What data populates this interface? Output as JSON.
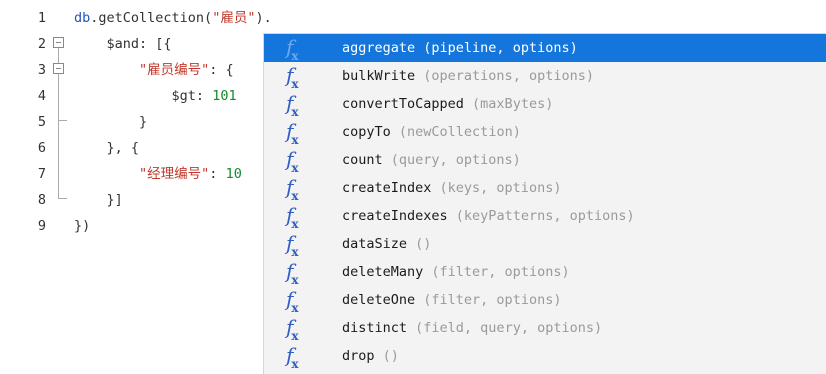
{
  "code_lines": [
    {
      "n": "1",
      "indent": "",
      "parts": [
        {
          "t": "db",
          "c": "kw"
        },
        {
          "t": ".getCollection(",
          "c": ""
        },
        {
          "t": "\"雇员\"",
          "c": "str"
        },
        {
          "t": ").",
          "c": ""
        }
      ]
    },
    {
      "n": "2",
      "indent": "    ",
      "parts": [
        {
          "t": "$and: [{",
          "c": ""
        }
      ]
    },
    {
      "n": "3",
      "indent": "        ",
      "parts": [
        {
          "t": "\"雇员编号\"",
          "c": "str"
        },
        {
          "t": ": {",
          "c": ""
        }
      ]
    },
    {
      "n": "4",
      "indent": "            ",
      "parts": [
        {
          "t": "$gt: ",
          "c": ""
        },
        {
          "t": "101",
          "c": "num"
        }
      ]
    },
    {
      "n": "5",
      "indent": "        ",
      "parts": [
        {
          "t": "}",
          "c": ""
        }
      ]
    },
    {
      "n": "6",
      "indent": "    ",
      "parts": [
        {
          "t": "}, {",
          "c": ""
        }
      ]
    },
    {
      "n": "7",
      "indent": "        ",
      "parts": [
        {
          "t": "\"经理编号\"",
          "c": "str"
        },
        {
          "t": ": ",
          "c": ""
        },
        {
          "t": "10",
          "c": "num"
        }
      ]
    },
    {
      "n": "8",
      "indent": "    ",
      "parts": [
        {
          "t": "}]",
          "c": ""
        }
      ]
    },
    {
      "n": "9",
      "indent": "",
      "parts": [
        {
          "t": "})",
          "c": ""
        }
      ]
    }
  ],
  "autocomplete": {
    "icon_glyph": "f",
    "icon_sub": "x",
    "selected_index": 0,
    "items": [
      {
        "name": "aggregate",
        "params": " (pipeline, options)"
      },
      {
        "name": "bulkWrite",
        "params": " (operations, options)"
      },
      {
        "name": "convertToCapped",
        "params": " (maxBytes)"
      },
      {
        "name": "copyTo",
        "params": " (newCollection)"
      },
      {
        "name": "count",
        "params": " (query, options)"
      },
      {
        "name": "createIndex",
        "params": " (keys, options)"
      },
      {
        "name": "createIndexes",
        "params": " (keyPatterns, options)"
      },
      {
        "name": "dataSize",
        "params": " ()"
      },
      {
        "name": "deleteMany",
        "params": " (filter, options)"
      },
      {
        "name": "deleteOne",
        "params": " (filter, options)"
      },
      {
        "name": "distinct",
        "params": " (field, query, options)"
      },
      {
        "name": "drop",
        "params": " ()"
      }
    ]
  }
}
